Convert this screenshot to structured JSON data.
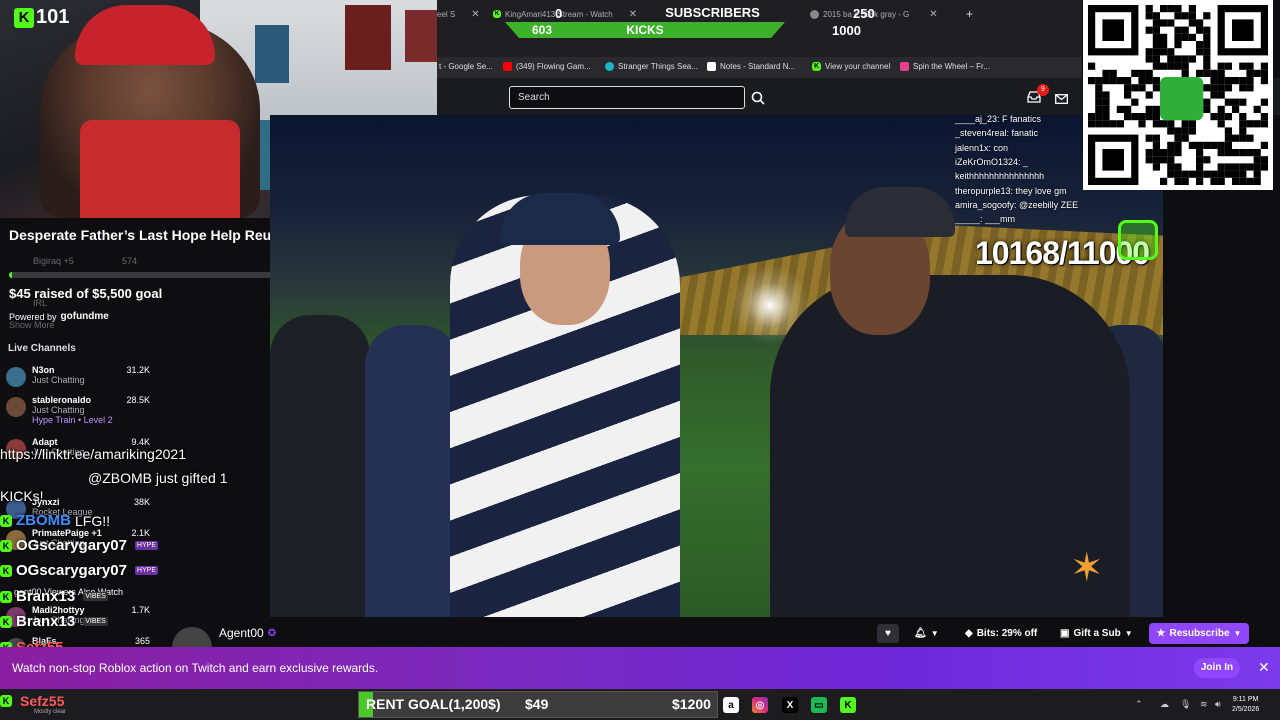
{
  "webcam": {
    "kick_count": "101"
  },
  "fundraiser": {
    "title": "Desperate Father’s Last Hope Help Reunite Me with My Son",
    "raised_text": "$45 raised of $5,500 goal",
    "progress_fraction": 0.008,
    "powered_by": "Powered by",
    "brand": "gofundme",
    "faint_user": "Bigiraq +5",
    "faint_count": "574",
    "faint_irl": "IRL",
    "show_more": "Show More"
  },
  "live_channels": {
    "heading": "Live Channels",
    "items": [
      {
        "name": "N3on",
        "game": "Just Chatting",
        "viewers": "31.2K",
        "color": "#3a6e8a"
      },
      {
        "name": "stableronaldo",
        "game": "Just Chatting",
        "viewers": "28.5K",
        "extra": "Hype Train • Level 2",
        "color": "#6a4a3a"
      },
      {
        "name": "Adapt",
        "game": "Just Chatting",
        "viewers": "9.4K",
        "color": "#8a3a3a"
      },
      {
        "name": "Jynxzi",
        "game": "Rocket League",
        "viewers": "38K",
        "color": "#3a5a8a"
      },
      {
        "name": "PrimatePaige +1",
        "game": "Just Chatting",
        "viewers": "2.1K",
        "color": "#8a6a3a"
      },
      {
        "name": "Madi2hottyy",
        "game": "Just Chatting",
        "viewers": "1.7K",
        "color": "#7a3a6a"
      },
      {
        "name": "BlaFs",
        "game": "",
        "viewers": "365",
        "color": "#4a4a4a"
      }
    ],
    "viewers_also_watch": "gent00 Viewers Also Watch"
  },
  "chat_overlay": {
    "link": "https://linktr.ee/amariking2021",
    "gift_line": "@ZBOMB just gifted 1",
    "gift_line2": "KICKs!",
    "lfg_user": "ZBOMB",
    "lfg_text": "LFG!!",
    "user1": "OGscarygary07",
    "user2": "OGscarygary07",
    "user3": "Branx13",
    "user4": "Branx13",
    "user5": "Sefz55",
    "hype": "HYPE",
    "vibes": "VIBES"
  },
  "browser": {
    "tabs": [
      {
        "label": "eel S"
      },
      {
        "label": "KingAmari413 Stream - Watch"
      },
      {
        "label": "2015 ba  e 528k gray - G"
      }
    ],
    "new_tab": "+",
    "counters": {
      "left_top": "0",
      "left_bottom": "603",
      "subs_label": "SUBSCRIBERS",
      "kicks_label": "KICKS",
      "right_top": "250",
      "right_bottom": "1000"
    },
    "bookmarks": [
      {
        "label": "t - Google Se...",
        "color": "#4285f4"
      },
      {
        "label": "(349) Flowing Gam...",
        "color": "#ff0000"
      },
      {
        "label": "Stranger Things Sea...",
        "color": "#1db4c8"
      },
      {
        "label": "Notes - Standard N...",
        "color": "#ffffff"
      },
      {
        "label": "View your channel",
        "color": "#53fc18"
      },
      {
        "label": "Spin the Wheel – Fr...",
        "color": "#e83e8c"
      }
    ]
  },
  "kick_header": {
    "search_placeholder": "Search",
    "notif_count": "9"
  },
  "video": {
    "goal": "10168/11000",
    "overlay_chat": [
      "____aj_23: F fanatics",
      "_steven4real: fanatic",
      "jalenn1x: con",
      "iZeKrOmO1324: _",
      "keithhhhhhhhhhhhhhh",
      "theropurple13: they love gm",
      "amira_sogoofy: @zeebilly ZEE",
      "_____: ___mm"
    ]
  },
  "toolbar": {
    "streamer": "Agent00",
    "bits": "Bits: 29% off",
    "gift_sub": "Gift a Sub",
    "resubscribe": "Resubscribe"
  },
  "promo": {
    "text": "Watch non-stop Roblox action on Twitch and earn exclusive rewards.",
    "join": "Join In",
    "close": "✕"
  },
  "rent_goal": {
    "label": "RENT GOAL(1,200$)",
    "current": "$49",
    "max": "$1200",
    "fraction": 0.04
  },
  "taskbar": {
    "user": "Sefz55",
    "weather": "Mostly clear",
    "time": "9:11 PM",
    "date": "2/5/2026"
  }
}
